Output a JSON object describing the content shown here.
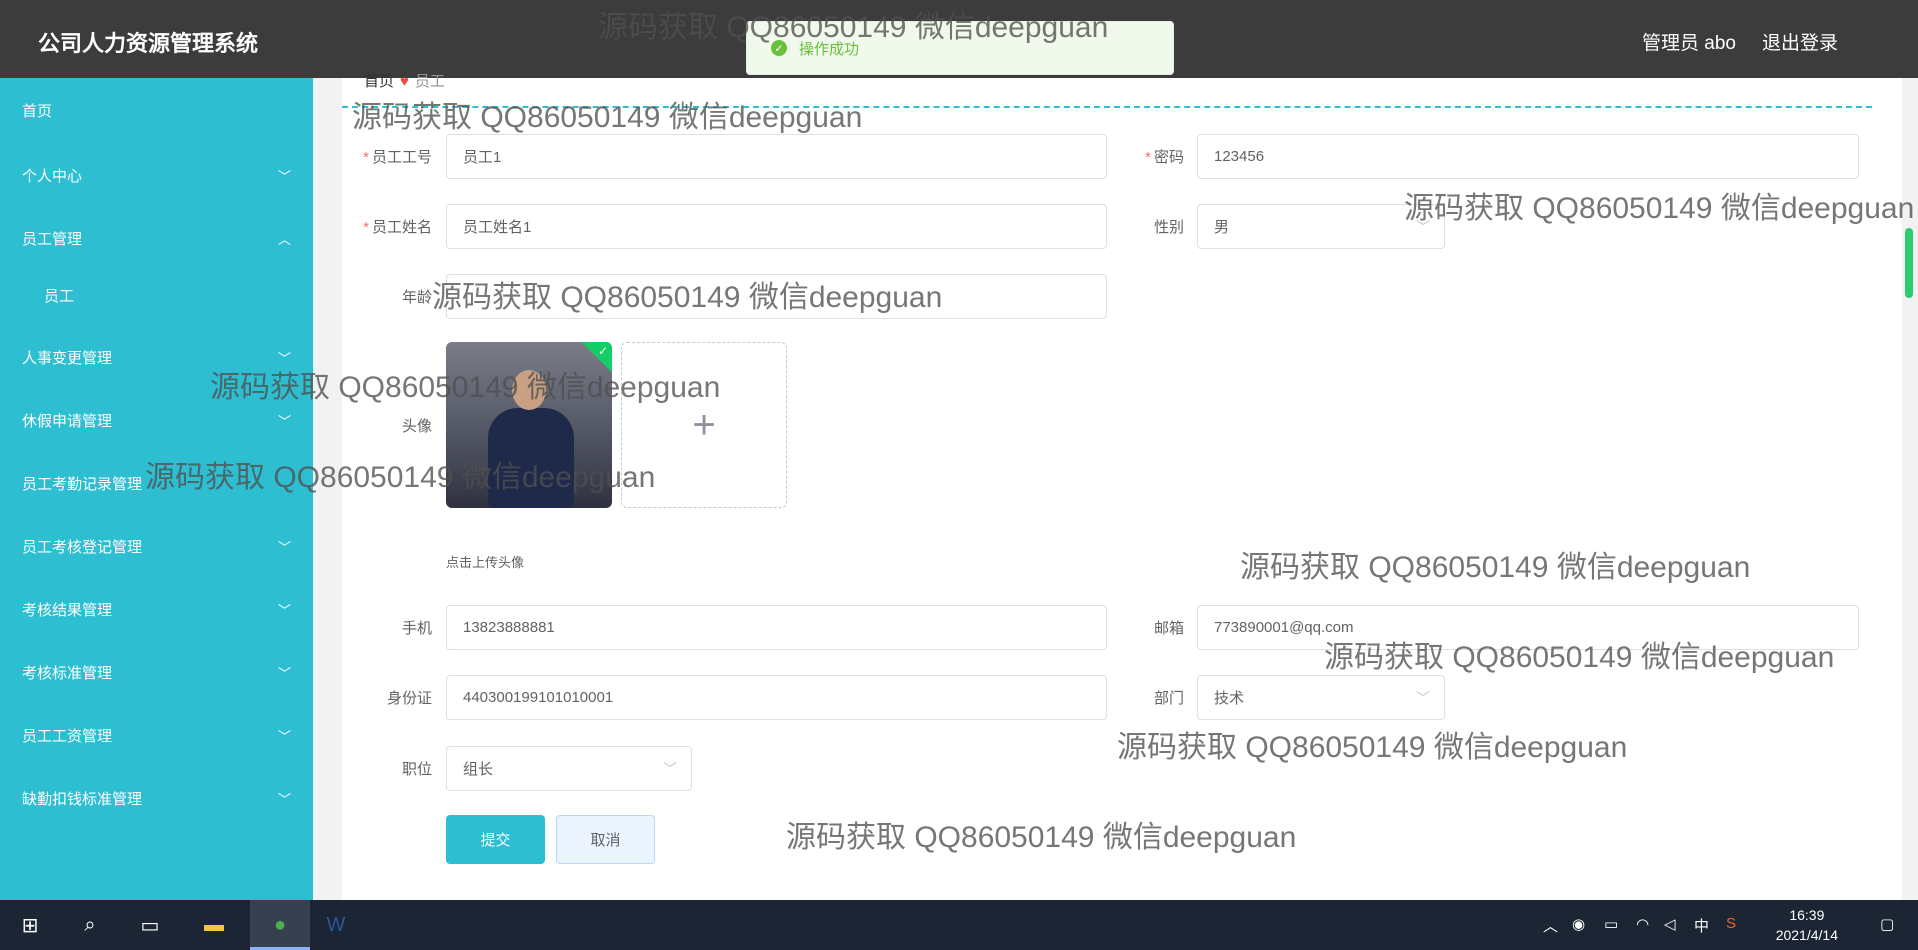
{
  "header": {
    "title": "公司人力资源管理系统",
    "user": "管理员 abo",
    "logout": "退出登录"
  },
  "toast": {
    "message": "操作成功"
  },
  "sidebar": {
    "items": [
      {
        "label": "首页"
      },
      {
        "label": "个人中心"
      },
      {
        "label": "员工管理"
      },
      {
        "label": "员工"
      },
      {
        "label": "人事变更管理"
      },
      {
        "label": "休假申请管理"
      },
      {
        "label": "员工考勤记录管理"
      },
      {
        "label": "员工考核登记管理"
      },
      {
        "label": "考核结果管理"
      },
      {
        "label": "考核标准管理"
      },
      {
        "label": "员工工资管理"
      },
      {
        "label": "缺勤扣钱标准管理"
      }
    ]
  },
  "breadcrumb": {
    "home": "首页",
    "current": "员工"
  },
  "form": {
    "emp_no": {
      "label": "员工工号",
      "value": "员工1"
    },
    "password": {
      "label": "密码",
      "value": "123456"
    },
    "emp_name": {
      "label": "员工姓名",
      "value": "员工姓名1"
    },
    "gender": {
      "label": "性别",
      "value": "男"
    },
    "age": {
      "label": "年龄",
      "value": ""
    },
    "avatar": {
      "label": "头像",
      "hint": "点击上传头像"
    },
    "phone": {
      "label": "手机",
      "value": "13823888881"
    },
    "email": {
      "label": "邮箱",
      "value": "773890001@qq.com"
    },
    "id_card": {
      "label": "身份证",
      "value": "440300199101010001"
    },
    "dept": {
      "label": "部门",
      "value": "技术"
    },
    "position": {
      "label": "职位",
      "value": "组长"
    },
    "submit": "提交",
    "cancel": "取消"
  },
  "watermark": "源码获取 QQ86050149 微信deepguan",
  "taskbar": {
    "time": "16:39",
    "date": "2021/4/14",
    "ime": "中"
  }
}
